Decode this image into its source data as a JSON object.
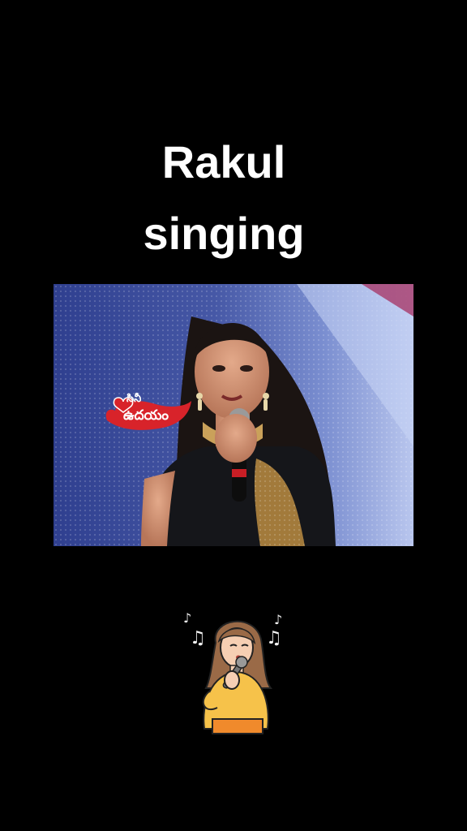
{
  "caption": {
    "line1": "Rakul",
    "line2": "singing"
  },
  "video": {
    "channel_logo": {
      "top_text": "సినీ",
      "main_text": "ఉదయం"
    }
  },
  "sticker": {
    "icon": "singing-girl-with-microphone",
    "notes": [
      "♪",
      "♫",
      "♪",
      "♫"
    ]
  },
  "colors": {
    "background": "#000000",
    "caption_text": "#ffffff",
    "logo_red": "#d8232a",
    "stage_blue": "#3c4f9a"
  }
}
